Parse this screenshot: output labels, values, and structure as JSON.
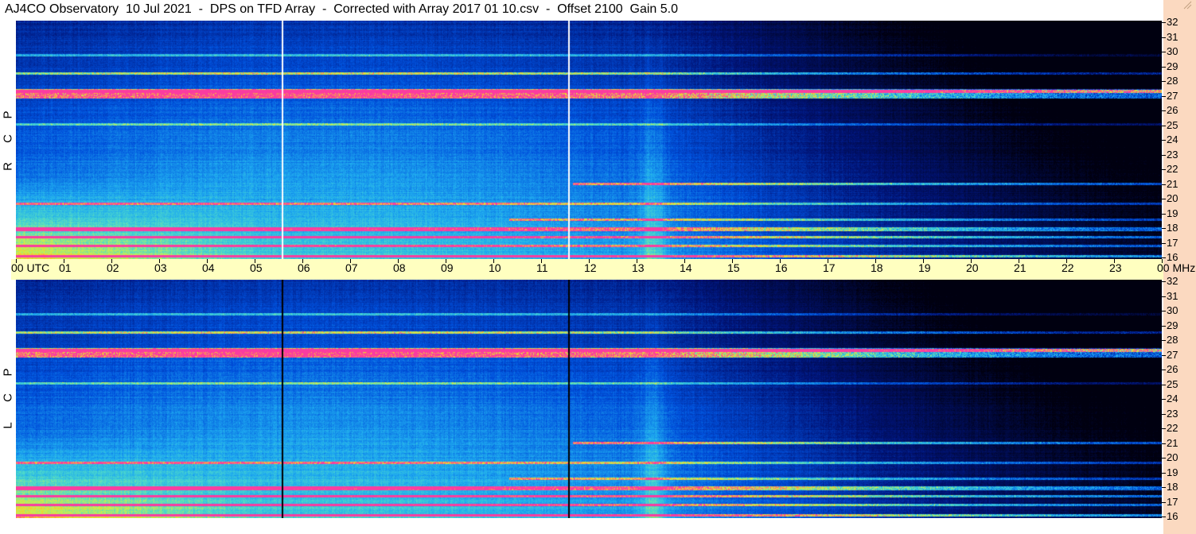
{
  "title": "AJ4CO Observatory  10 Jul 2021  -  DPS on TFD Array  -  Corrected with Array 2017 01 10.csv  -  Offset 2100  Gain 5.0",
  "panels": [
    {
      "id": "top",
      "polarization_letters": [
        "R",
        "C",
        "P"
      ]
    },
    {
      "id": "bottom",
      "polarization_letters": [
        "L",
        "C",
        "P"
      ]
    }
  ],
  "time_axis": {
    "labels": [
      "00 UTC",
      "01",
      "02",
      "03",
      "04",
      "05",
      "06",
      "07",
      "08",
      "09",
      "10",
      "11",
      "12",
      "13",
      "14",
      "15",
      "16",
      "17",
      "18",
      "19",
      "20",
      "21",
      "22",
      "23",
      "00 MHz"
    ]
  },
  "freq_axis": {
    "labels": [
      "32",
      "31",
      "30",
      "29",
      "28",
      "27",
      "26",
      "25",
      "24",
      "23",
      "22",
      "21",
      "20",
      "19",
      "18",
      "17",
      "16"
    ]
  },
  "colors": {
    "background": "#ffffff",
    "time_axis_bg": "#ffffc0",
    "right_strip_bg": "#fbd9c0",
    "spectrogram_dark": "#000010",
    "spectrogram_mid": "#0040d0",
    "spectrogram_light": "#20b0f0",
    "spectrogram_hot": "#f0f040"
  }
}
